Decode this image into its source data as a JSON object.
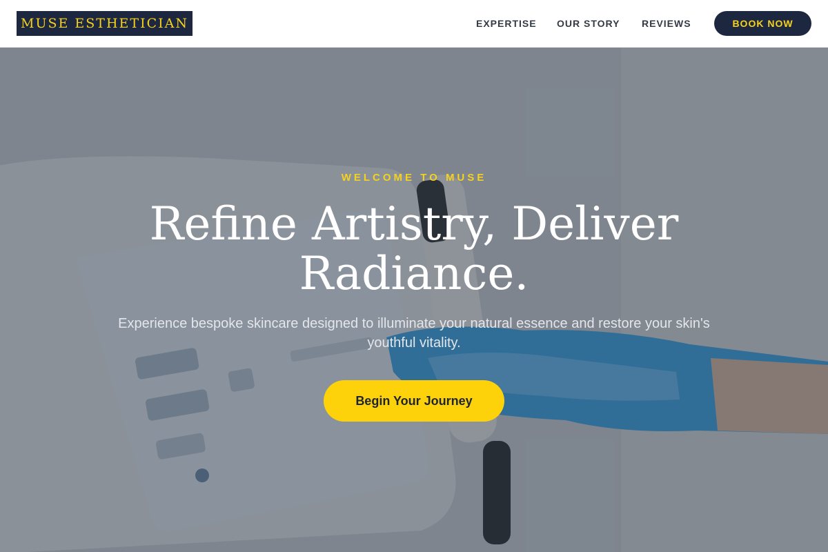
{
  "header": {
    "logo": "MUSE ESTHETICIAN",
    "nav": [
      "EXPERTISE",
      "OUR STORY",
      "REVIEWS"
    ],
    "book_button": "BOOK NOW"
  },
  "hero": {
    "eyebrow": "WELCOME TO MUSE",
    "headline": "Refine Artistry, Deliver Radiance.",
    "subtext": "Experience bespoke skincare designed to illuminate your natural essence and restore your skin's youthful vitality.",
    "cta": "Begin Your Journey"
  },
  "colors": {
    "navy": "#1d2840",
    "gold": "#f5d21f",
    "cta_yellow": "#fdd20a"
  }
}
